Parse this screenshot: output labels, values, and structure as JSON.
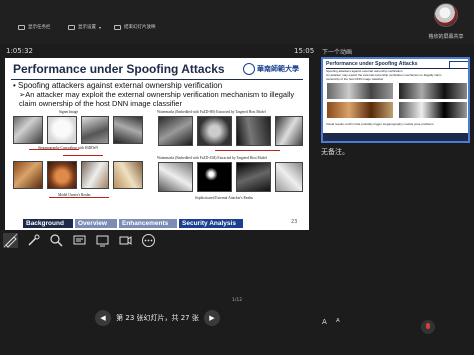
{
  "toolbar": {
    "items": [
      "显示任务栏",
      "显示设置",
      "结束幻灯片放映"
    ]
  },
  "user": {
    "name": "格欣的屏幕共享"
  },
  "presenter": {
    "timer": "1:05:32",
    "clock": "15:05"
  },
  "slide": {
    "title": "Performance under Spoofing Attacks",
    "logo_text": "華南師範大學",
    "bullet1": "Spoofing attackers against external ownership verification",
    "bullet2": "An attacker may exploit the external ownership verification mechanism to illegally claim ownership of the host DNN image classifier",
    "captions": {
      "signet": "Signet Image",
      "pretrained": "Steganography Concealing with HiDDeN",
      "owner": "Model Owner's Realm",
      "wm_fd": "Watermarks (Embedded with FaZD-HS) Extracted by Targeted Host Model",
      "wm_fd2": "Watermarks (Embedded with FaZD-Z04) Extracted by Targeted Host Model",
      "attacker": "Sophisticated External Attacker's Realm"
    },
    "footer_nav": [
      "Background",
      "Overview",
      "Enhancements",
      "Security Analysis"
    ],
    "page_number": "23"
  },
  "navigation": {
    "page_count": "1/12",
    "current_text": "第 23 张幻灯片，共 27 张",
    "prev": "◀",
    "next": "▶"
  },
  "next_slide": {
    "label": "下一个动画",
    "title": "Performance under Spoofing Attacks",
    "bullet1": "Spoofing attackers against external ownership verification",
    "bullet2": "An attacker may exploit the external ownership verification mechanism to illegally claim ownership of the host DNN image classifier",
    "bottom_note": "Visual results confirm that probably trigger steganography models pose problems"
  },
  "notes": {
    "text": "无备注。"
  },
  "font_controls": {
    "increase": "A",
    "decrease": "A"
  },
  "colors": {
    "accent": "#4a7bd6",
    "slide_title": "#1d2a4a",
    "nav_active": "#1a3f8f"
  }
}
